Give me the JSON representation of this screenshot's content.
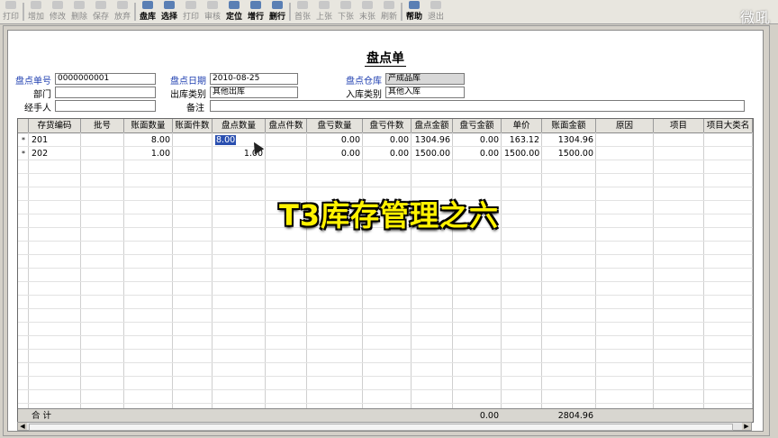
{
  "toolbar": {
    "buttons": [
      {
        "label": "打印",
        "enabled": false
      },
      {
        "label": "增加",
        "enabled": false
      },
      {
        "label": "修改",
        "enabled": false
      },
      {
        "label": "删除",
        "enabled": false
      },
      {
        "label": "保存",
        "enabled": false
      },
      {
        "label": "放弃",
        "enabled": false
      },
      {
        "label": "盘库",
        "enabled": true
      },
      {
        "label": "选择",
        "enabled": true
      },
      {
        "label": "打印",
        "enabled": false
      },
      {
        "label": "审核",
        "enabled": false
      },
      {
        "label": "定位",
        "enabled": true
      },
      {
        "label": "增行",
        "enabled": true
      },
      {
        "label": "删行",
        "enabled": true
      },
      {
        "label": "首张",
        "enabled": false
      },
      {
        "label": "上张",
        "enabled": false
      },
      {
        "label": "下张",
        "enabled": false
      },
      {
        "label": "末张",
        "enabled": false
      },
      {
        "label": "刷新",
        "enabled": false
      },
      {
        "label": "帮助",
        "enabled": true
      },
      {
        "label": "退出",
        "enabled": false
      }
    ]
  },
  "watermark": "微吼",
  "form": {
    "title": "盘点单",
    "fields": {
      "doc_no_label": "盘点单号",
      "doc_no": "0000000001",
      "date_label": "盘点日期",
      "date": "2010-08-25",
      "warehouse_label": "盘点仓库",
      "warehouse": "产成品库",
      "dept_label": "部门",
      "dept": "",
      "out_type_label": "出库类别",
      "out_type": "其他出库",
      "in_type_label": "入库类别",
      "in_type": "其他入库",
      "handler_label": "经手人",
      "handler": "",
      "remark_label": "备注",
      "remark": ""
    }
  },
  "grid": {
    "columns": [
      "存货编码",
      "批号",
      "账面数量",
      "账面件数",
      "盘点数量",
      "盘点件数",
      "盘亏数量",
      "盘亏件数",
      "盘点金额",
      "盘亏金额",
      "单价",
      "账面金额",
      "原因",
      "项目",
      "项目大类名"
    ],
    "rows": [
      {
        "mark": "*",
        "code": "201",
        "batch": "",
        "book_qty": "8.00",
        "book_pcs": "",
        "count_qty": "8.00",
        "count_pcs": "",
        "loss_qty": "0.00",
        "loss_pcs": "0.00",
        "count_amt": "1304.96",
        "loss_amt": "0.00",
        "price": "163.12",
        "book_amt": "1304.96",
        "reason": "",
        "project": "",
        "project_class": ""
      },
      {
        "mark": "*",
        "code": "202",
        "batch": "",
        "book_qty": "1.00",
        "book_pcs": "",
        "count_qty": "1.00",
        "count_pcs": "",
        "loss_qty": "0.00",
        "loss_pcs": "0.00",
        "count_amt": "1500.00",
        "loss_amt": "0.00",
        "price": "1500.00",
        "book_amt": "1500.00",
        "reason": "",
        "project": "",
        "project_class": ""
      }
    ],
    "total": {
      "label": "合 计",
      "loss_amt": "0.00",
      "book_amt": "2804.96"
    }
  },
  "overlay_caption": "T3库存管理之六"
}
